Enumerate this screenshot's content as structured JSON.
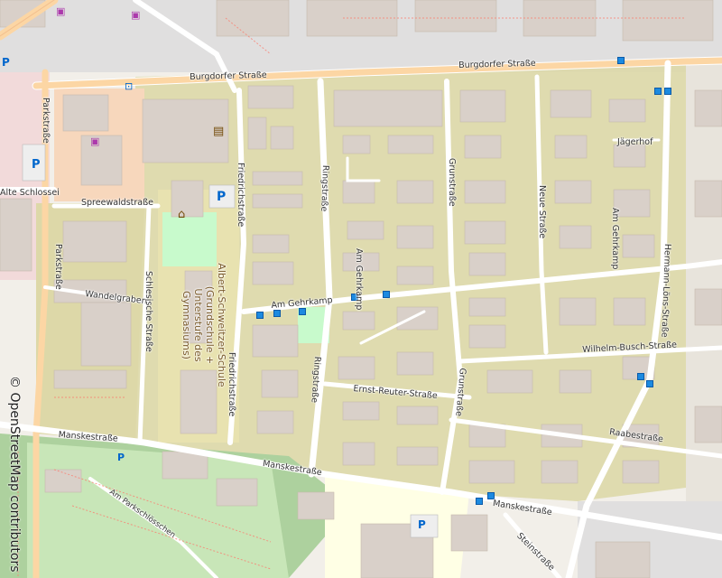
{
  "map": {
    "attribution": "© OpenStreetMap contributors",
    "colors": {
      "background": "#f2efe9",
      "residential": "#ddd8a8",
      "building": "#d9d0c9",
      "road": "#ffffff",
      "primary_road": "#fcd6a4",
      "park": "#c8facc",
      "school": "#ffffe5",
      "bus_stop": "#1c8ae0"
    }
  },
  "streets": [
    {
      "name": "Burgdorfer Straße"
    },
    {
      "name": "Burgdorfer Straße"
    },
    {
      "name": "Parkstraße"
    },
    {
      "name": "Parkstraße"
    },
    {
      "name": "Alte Schlossei"
    },
    {
      "name": "Spreewaldstraße"
    },
    {
      "name": "Wandelgraben"
    },
    {
      "name": "Schlesische Straße"
    },
    {
      "name": "Friedrichstraße"
    },
    {
      "name": "Friedrichstraße"
    },
    {
      "name": "Ringstraße"
    },
    {
      "name": "Ringstraße"
    },
    {
      "name": "Am Gehrkamp"
    },
    {
      "name": "Am Gehrkamp"
    },
    {
      "name": "Am Gehrkamp"
    },
    {
      "name": "Grunstraße"
    },
    {
      "name": "Grunstraße"
    },
    {
      "name": "Neue Straße"
    },
    {
      "name": "Jägerhof"
    },
    {
      "name": "Hermann-Löns-Straße"
    },
    {
      "name": "Wilhelm-Busch-Straße"
    },
    {
      "name": "Ernst-Reuter-Straße"
    },
    {
      "name": "Raabestraße"
    },
    {
      "name": "Manskestraße"
    },
    {
      "name": "Manskestraße"
    },
    {
      "name": "Manskestraße"
    },
    {
      "name": "Am Parkschlösschen"
    },
    {
      "name": "Steinstraße"
    }
  ],
  "areas": [
    {
      "name": "Albert-Schweitzer-Schule (Grundschule + Unterstufe des Gymnasiums)"
    }
  ],
  "icons": [
    "parking-icon",
    "library-icon",
    "theatre-icon",
    "bus-stop-icon",
    "shop-icon"
  ]
}
